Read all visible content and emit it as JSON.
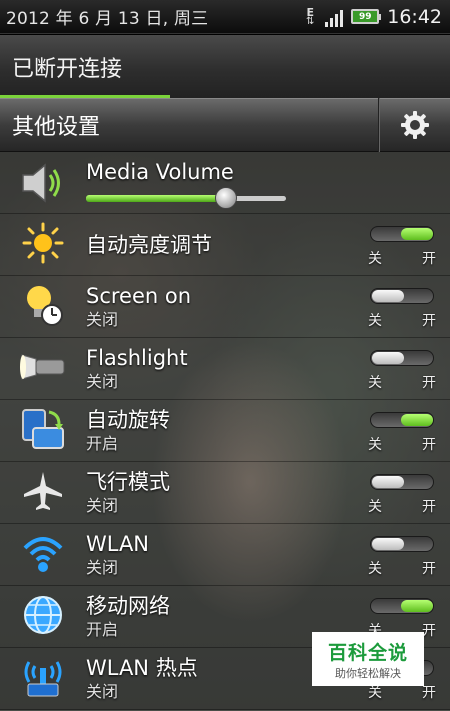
{
  "status_bar": {
    "date": "2012 年 6 月 13 日, 周三",
    "data_type": "E",
    "battery": "99",
    "time": "16:42"
  },
  "connection": {
    "label": "已断开连接"
  },
  "other_settings": {
    "title": "其他设置",
    "icon": "gear-icon"
  },
  "media_volume": {
    "label": "Media Volume",
    "level": 0.7,
    "icon": "speaker-icon"
  },
  "toggles": [
    {
      "name": "自动亮度调节",
      "state": "",
      "on": true,
      "icon": "sun-icon",
      "off_label": "关",
      "on_label": "开"
    },
    {
      "name": "Screen on",
      "state": "关闭",
      "on": false,
      "icon": "bulb-clock-icon",
      "off_label": "关",
      "on_label": "开"
    },
    {
      "name": "Flashlight",
      "state": "关闭",
      "on": false,
      "icon": "flashlight-icon",
      "off_label": "关",
      "on_label": "开"
    },
    {
      "name": "自动旋转",
      "state": "开启",
      "on": true,
      "icon": "rotate-icon",
      "off_label": "关",
      "on_label": "开"
    },
    {
      "name": "飞行模式",
      "state": "关闭",
      "on": false,
      "icon": "airplane-icon",
      "off_label": "关",
      "on_label": "开"
    },
    {
      "name": "WLAN",
      "state": "关闭",
      "on": false,
      "icon": "wifi-icon",
      "off_label": "关",
      "on_label": "开"
    },
    {
      "name": "移动网络",
      "state": "开启",
      "on": true,
      "icon": "globe-icon",
      "off_label": "关",
      "on_label": "开"
    },
    {
      "name": "WLAN 热点",
      "state": "关闭",
      "on": false,
      "icon": "hotspot-icon",
      "off_label": "关",
      "on_label": "开"
    }
  ],
  "watermark": {
    "title": "百科全说",
    "subtitle": "助你轻松解决"
  },
  "colors": {
    "accent_green": "#7ad23a",
    "watermark_green": "#1c9b3c"
  }
}
